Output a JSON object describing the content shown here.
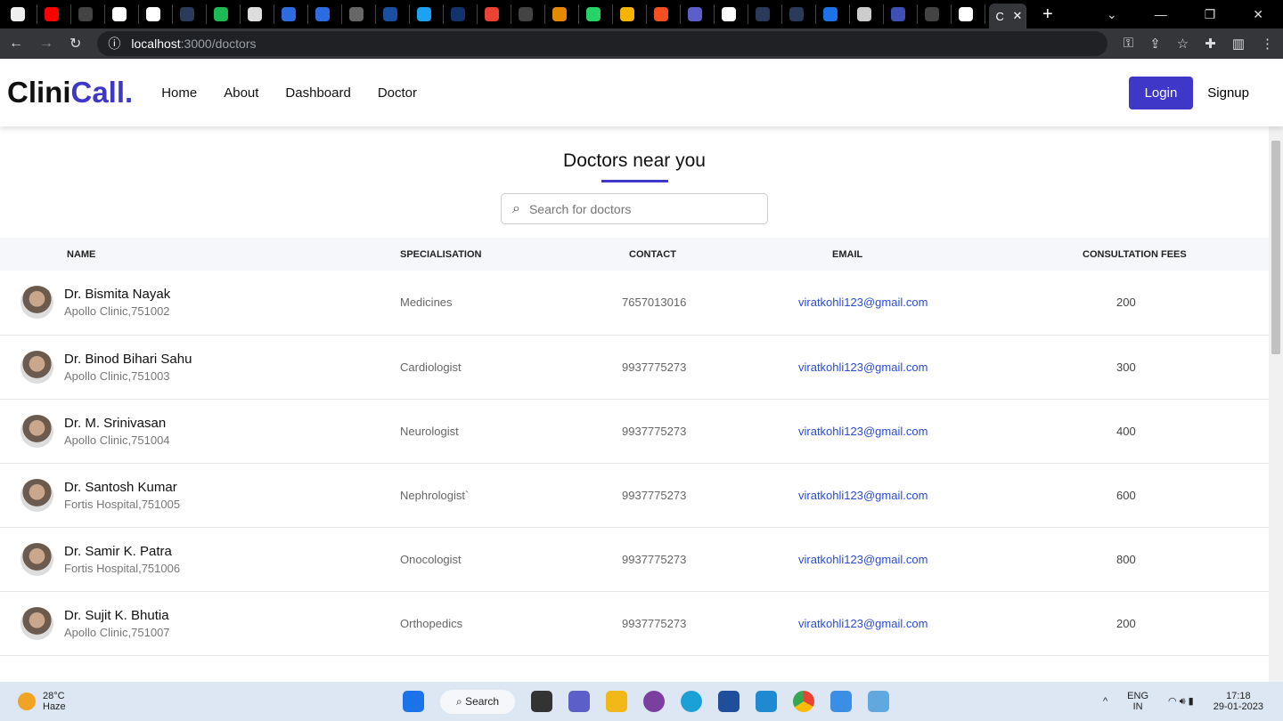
{
  "browser": {
    "url_host": "localhost",
    "url_path": ":3000/doctors",
    "active_tab_letter": "C"
  },
  "nav": {
    "logo_a": "Clini",
    "logo_b": "Call.",
    "links": [
      "Home",
      "About",
      "Dashboard",
      "Doctor"
    ],
    "login": "Login",
    "signup": "Signup"
  },
  "page": {
    "title": "Doctors near you",
    "search_placeholder": "Search for doctors"
  },
  "table": {
    "headers": [
      "NAME",
      "SPECIALISATION",
      "CONTACT",
      "EMAIL",
      "CONSULTATION FEES"
    ],
    "rows": [
      {
        "name": "Dr. Bismita Nayak",
        "clinic": "Apollo Clinic,751002",
        "spec": "Medicines",
        "contact": "7657013016",
        "email": "viratkohli123@gmail.com",
        "fee": "200"
      },
      {
        "name": "Dr. Binod Bihari Sahu",
        "clinic": "Apollo Clinic,751003",
        "spec": "Cardiologist",
        "contact": "9937775273",
        "email": "viratkohli123@gmail.com",
        "fee": "300"
      },
      {
        "name": "Dr. M. Srinivasan",
        "clinic": "Apollo Clinic,751004",
        "spec": "Neurologist",
        "contact": "9937775273",
        "email": "viratkohli123@gmail.com",
        "fee": "400"
      },
      {
        "name": "Dr. Santosh Kumar",
        "clinic": "Fortis Hospital,751005",
        "spec": "Nephrologist`",
        "contact": "9937775273",
        "email": "viratkohli123@gmail.com",
        "fee": "600"
      },
      {
        "name": "Dr. Samir K. Patra",
        "clinic": "Fortis Hospital,751006",
        "spec": "Onocologist",
        "contact": "9937775273",
        "email": "viratkohli123@gmail.com",
        "fee": "800"
      },
      {
        "name": "Dr. Sujit K. Bhutia",
        "clinic": "Apollo Clinic,751007",
        "spec": "Orthopedics",
        "contact": "9937775273",
        "email": "viratkohli123@gmail.com",
        "fee": "200"
      }
    ]
  },
  "taskbar": {
    "temp": "28°C",
    "weather": "Haze",
    "search": "Search",
    "lang1": "ENG",
    "lang2": "IN",
    "time": "17:18",
    "date": "29-01-2023"
  },
  "colors": {
    "brand": "#3e37c8",
    "email": "#2a4bd7"
  }
}
